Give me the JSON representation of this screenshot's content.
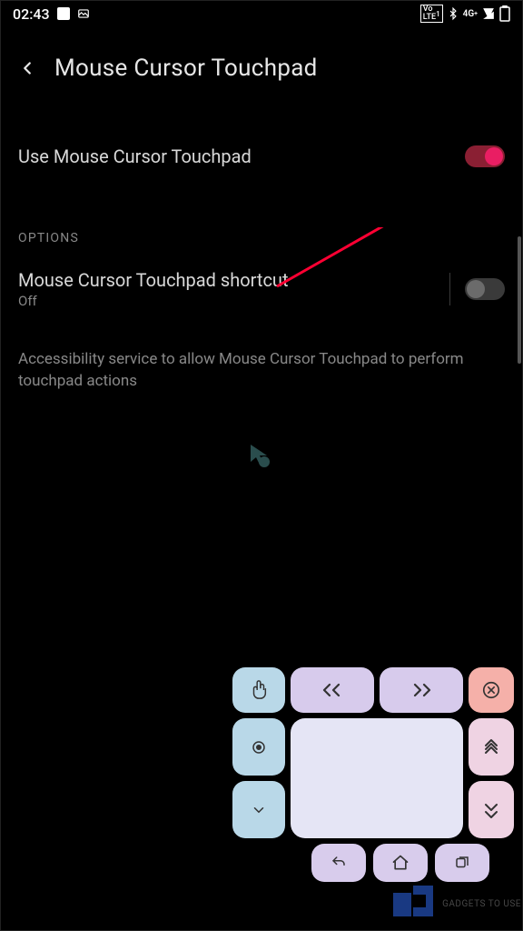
{
  "status": {
    "time": "02:43",
    "icons": [
      "stop",
      "gallery"
    ],
    "right": [
      "VoLTE1",
      "bt",
      "4G+",
      "signal",
      "battery"
    ]
  },
  "header": {
    "title": "Mouse Cursor Touchpad"
  },
  "main": {
    "use_label": "Use Mouse Cursor Touchpad",
    "options_label": "OPTIONS",
    "shortcut": {
      "title": "Mouse Cursor Touchpad shortcut",
      "state": "Off"
    },
    "description": "Accessibility service to allow Mouse Cursor Touchpad to perform touchpad actions"
  },
  "watermark": "GADGETS TO USE"
}
